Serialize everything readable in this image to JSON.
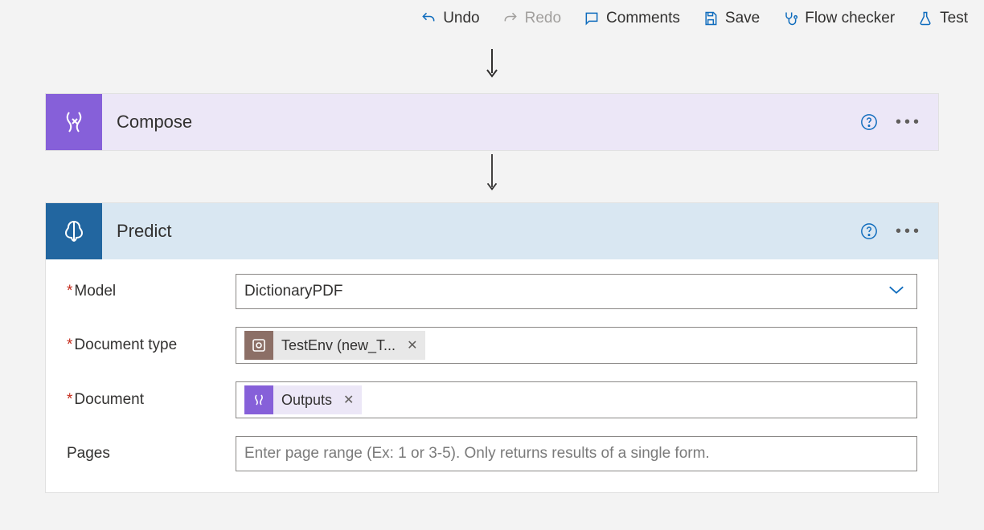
{
  "toolbar": {
    "undo": "Undo",
    "redo": "Redo",
    "comments": "Comments",
    "save": "Save",
    "flow_checker": "Flow checker",
    "test": "Test"
  },
  "compose": {
    "title": "Compose"
  },
  "predict": {
    "title": "Predict",
    "fields": {
      "model_label": "Model",
      "model_value": "DictionaryPDF",
      "document_type_label": "Document type",
      "document_type_token": "TestEnv (new_T...",
      "document_label": "Document",
      "document_token": "Outputs",
      "pages_label": "Pages",
      "pages_placeholder": "Enter page range (Ex: 1 or 3-5). Only returns results of a single form."
    }
  },
  "colors": {
    "accent_blue": "#0f6cbd",
    "compose_purple": "#8660d9",
    "predict_blue": "#2266a0"
  }
}
